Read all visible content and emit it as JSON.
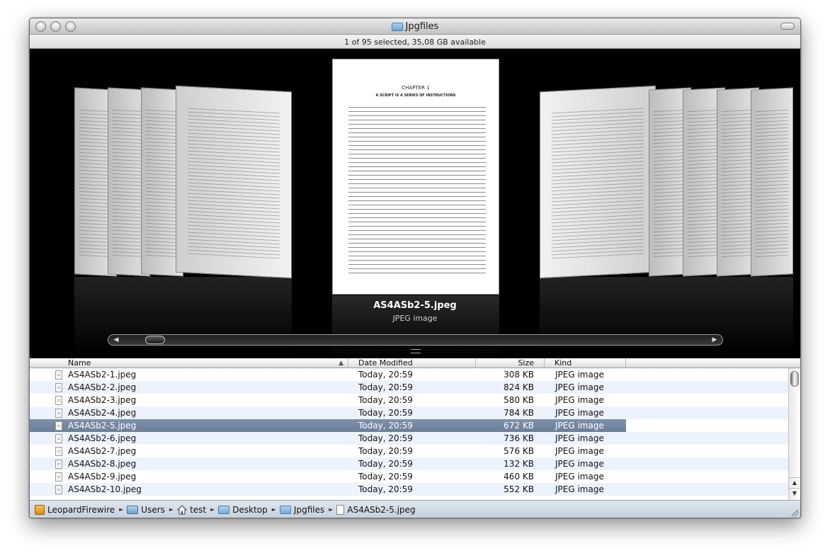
{
  "window": {
    "title": "Jpgfiles",
    "status": "1 of 95 selected, 35,08 GB available"
  },
  "coverflow": {
    "selected_name": "AS4ASb2-5.jpeg",
    "selected_kind": "JPEG image",
    "center_page": {
      "chapter": "CHAPTER 1",
      "subtitle": "A SCRIPT IS A SERIES OF INSTRUCTIONS"
    }
  },
  "columns": {
    "name": "Name",
    "date": "Date Modified",
    "size": "Size",
    "kind": "Kind"
  },
  "files": [
    {
      "name": "AS4ASb2-1.jpeg",
      "date": "Today, 20:59",
      "size": "308 KB",
      "kind": "JPEG image"
    },
    {
      "name": "AS4ASb2-2.jpeg",
      "date": "Today, 20:59",
      "size": "824 KB",
      "kind": "JPEG image"
    },
    {
      "name": "AS4ASb2-3.jpeg",
      "date": "Today, 20:59",
      "size": "580 KB",
      "kind": "JPEG image"
    },
    {
      "name": "AS4ASb2-4.jpeg",
      "date": "Today, 20:59",
      "size": "784 KB",
      "kind": "JPEG image"
    },
    {
      "name": "AS4ASb2-5.jpeg",
      "date": "Today, 20:59",
      "size": "672 KB",
      "kind": "JPEG image"
    },
    {
      "name": "AS4ASb2-6.jpeg",
      "date": "Today, 20:59",
      "size": "736 KB",
      "kind": "JPEG image"
    },
    {
      "name": "AS4ASb2-7.jpeg",
      "date": "Today, 20:59",
      "size": "576 KB",
      "kind": "JPEG image"
    },
    {
      "name": "AS4ASb2-8.jpeg",
      "date": "Today, 20:59",
      "size": "132 KB",
      "kind": "JPEG image"
    },
    {
      "name": "AS4ASb2-9.jpeg",
      "date": "Today, 20:59",
      "size": "460 KB",
      "kind": "JPEG image"
    },
    {
      "name": "AS4ASb2-10.jpeg",
      "date": "Today, 20:59",
      "size": "552 KB",
      "kind": "JPEG image"
    }
  ],
  "pathbar": {
    "items": [
      "LeopardFirewire",
      "Users",
      "test",
      "Desktop",
      "Jpgfiles",
      "AS4ASb2-5.jpeg"
    ]
  }
}
